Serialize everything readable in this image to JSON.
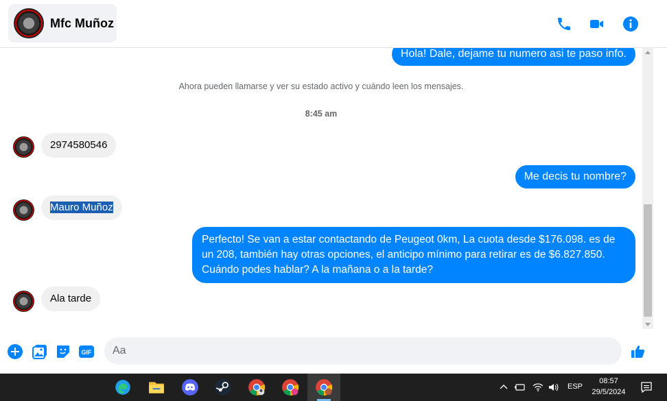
{
  "header": {
    "contact_name": "Mfc Muñoz",
    "icons": [
      "phone-icon",
      "video-icon",
      "info-icon"
    ]
  },
  "messages": {
    "out_1": "Hola! Dale, dejame tu numero asi te paso info.",
    "system": "Ahora pueden llamarse y ver su estado activo y cuándo leen los mensajes.",
    "time": "8:45 am",
    "in_1": "2974580546",
    "out_2": "Me decis tu nombre?",
    "in_2": "Mauro Muñoz",
    "out_3": "Perfecto!  Se van a estar contactando de Peugeot 0km, La cuota desde $176.098. es de un 208, también hay otras opciones, el anticipo mínimo para retirar es de $6.827.850. Cuándo podes hablar? A la mañana o a la tarde?",
    "in_3": "Ala tarde"
  },
  "composer": {
    "placeholder": "Aa",
    "gif_label": "GIF"
  },
  "taskbar": {
    "language": "ESP",
    "time": "08:57",
    "date": "29/5/2024"
  },
  "colors": {
    "accent": "#0084ff",
    "bubble_in": "#f0f0f0",
    "taskbar": "#1f1f1f"
  }
}
